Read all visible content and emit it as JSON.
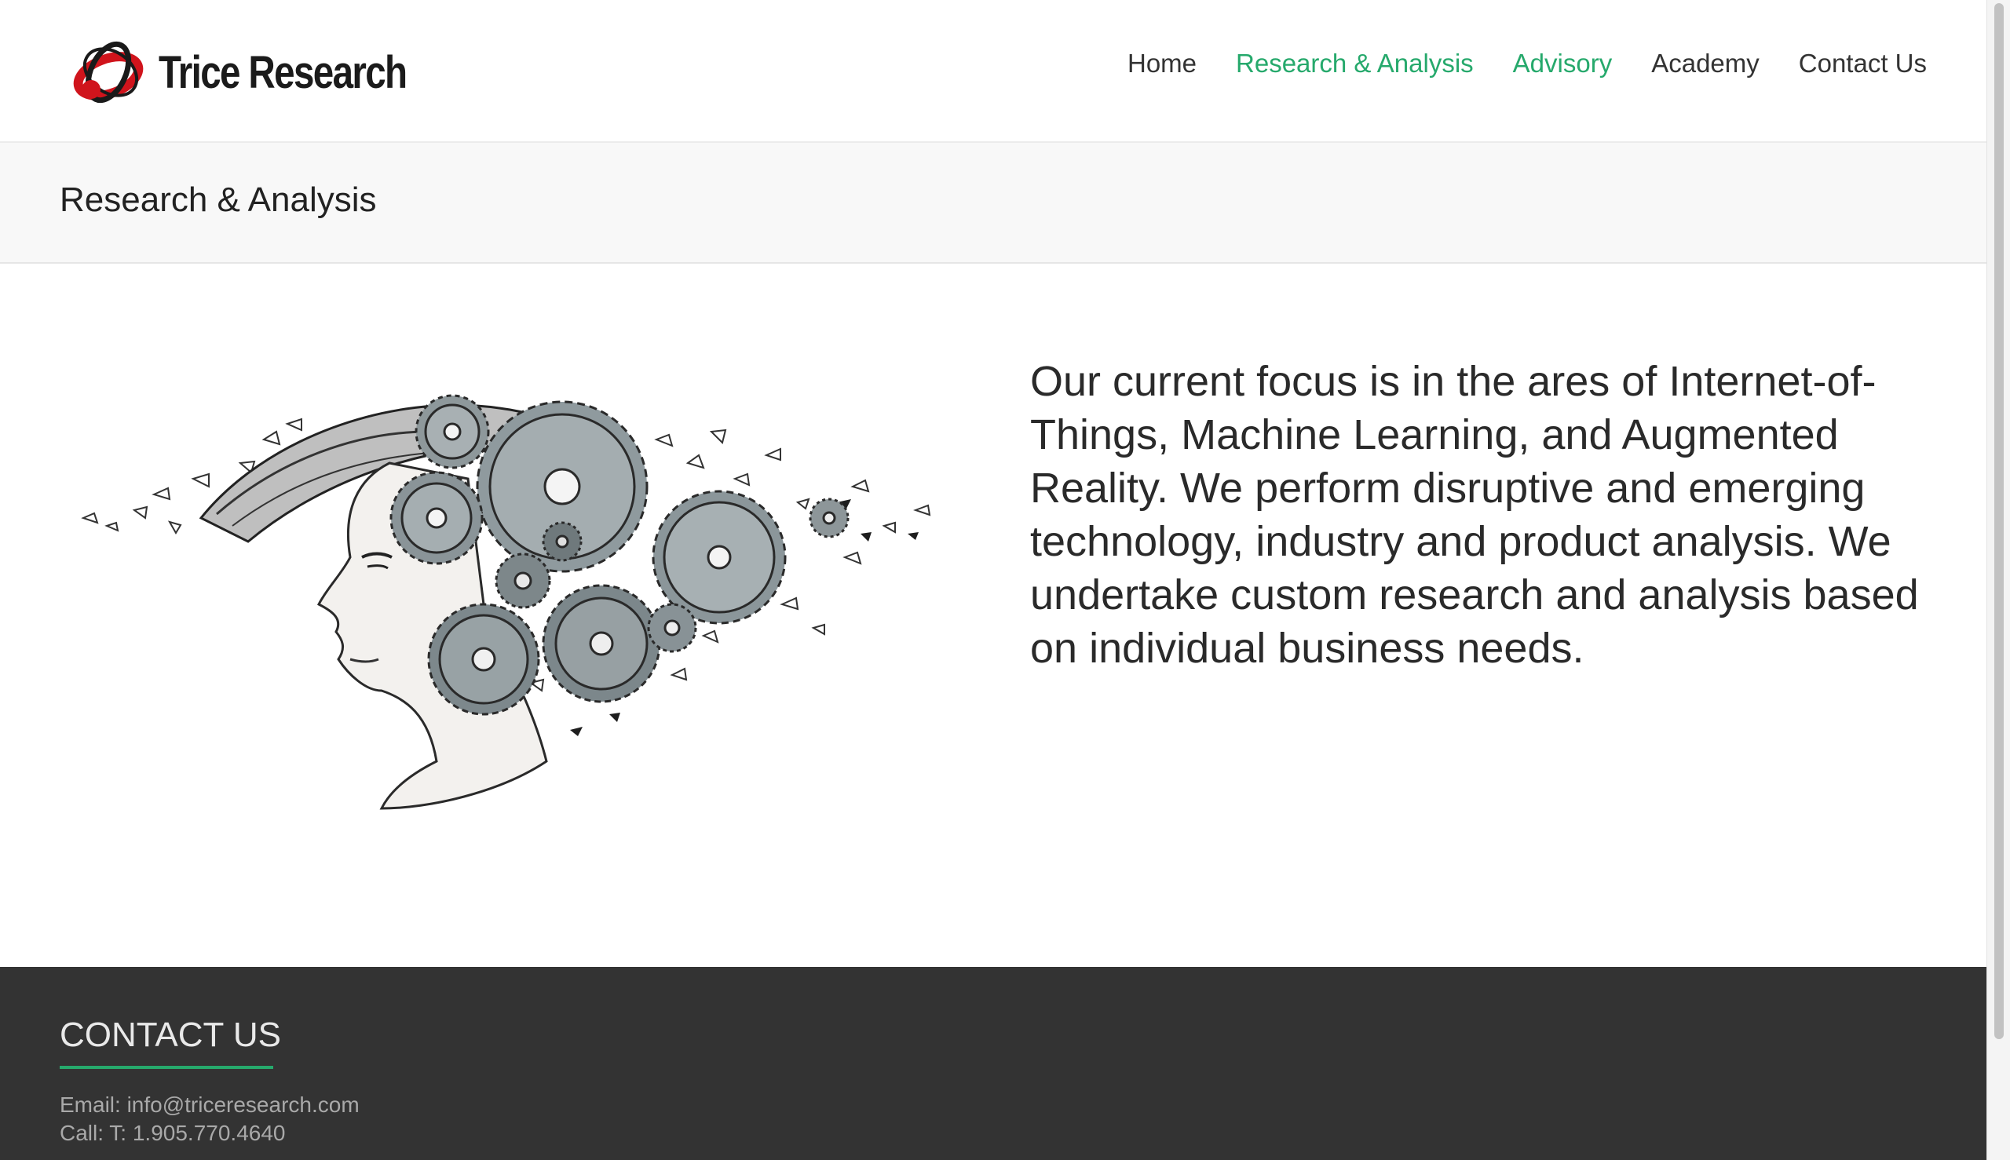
{
  "site": {
    "logo_text": "Trice Research"
  },
  "nav": {
    "items": [
      {
        "label": "Home"
      },
      {
        "label": "Research & Analysis"
      },
      {
        "label": "Advisory"
      },
      {
        "label": "Academy"
      },
      {
        "label": "Contact Us"
      }
    ]
  },
  "page": {
    "title": "Research & Analysis",
    "lead": "Our current focus is in the ares of Internet-of-Things, Machine Learning, and Augmented Reality. We perform disruptive and emerging technology, industry and product analysis. We undertake custom research and analysis based on individual business needs."
  },
  "footer": {
    "heading": "CONTACT US",
    "email_line": "Email: info@triceresearch.com",
    "call_line": "Call: T: 1.905.770.4640"
  },
  "colors": {
    "accent": "#26a96c",
    "footer_bg": "#333333",
    "logo_red": "#d0141c"
  },
  "icons": {
    "logo": "trice-orbit-logo-icon",
    "illustration": "head-with-gears-illustration"
  }
}
